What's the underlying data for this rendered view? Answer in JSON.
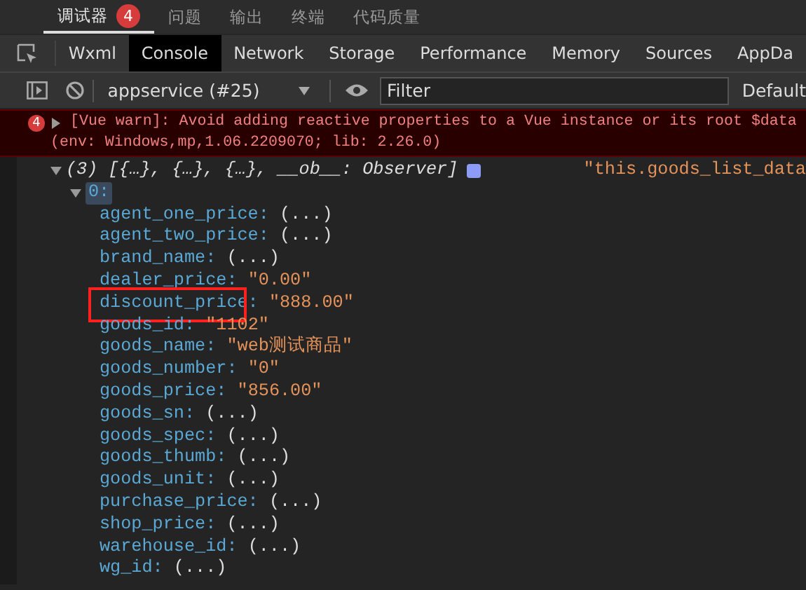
{
  "top_tabs": [
    {
      "label": "调试器",
      "selected": true,
      "badge": "4"
    },
    {
      "label": "问题",
      "selected": false
    },
    {
      "label": "输出",
      "selected": false
    },
    {
      "label": "终端",
      "selected": false
    },
    {
      "label": "代码质量",
      "selected": false
    }
  ],
  "panel_tabs": [
    {
      "label": "Wxml",
      "selected": false
    },
    {
      "label": "Console",
      "selected": true
    },
    {
      "label": "Network",
      "selected": false
    },
    {
      "label": "Storage",
      "selected": false
    },
    {
      "label": "Performance",
      "selected": false
    },
    {
      "label": "Memory",
      "selected": false
    },
    {
      "label": "Sources",
      "selected": false
    },
    {
      "label": "AppDa",
      "selected": false
    }
  ],
  "toolbar": {
    "context": "appservice (#25)",
    "filter_placeholder": "Filter",
    "levels": "Default"
  },
  "warning": {
    "count": "4",
    "lines": [
      "[Vue warn]: Avoid adding reactive properties to a Vue instance or its root $data",
      "(env: Windows,mp,1.06.2209070; lib: 2.26.0)"
    ]
  },
  "log": {
    "summary": "(3) [{…}, {…}, {…}, __ob__: Observer]",
    "source": "\"this.goods_list_data",
    "expanded": true,
    "item": {
      "label": "0:",
      "selected": true,
      "expanded": true,
      "fields": [
        {
          "key": "agent_one_price:",
          "value": "(...)",
          "kind": "getter",
          "highlighted": false
        },
        {
          "key": "agent_two_price:",
          "value": "(...)",
          "kind": "getter",
          "highlighted": false
        },
        {
          "key": "brand_name:",
          "value": "(...)",
          "kind": "getter",
          "highlighted": false
        },
        {
          "key": "dealer_price:",
          "value": "\"0.00\"",
          "kind": "string",
          "highlighted": false
        },
        {
          "key": "discount_price:",
          "value": "\"888.00\"",
          "kind": "string",
          "highlighted": true
        },
        {
          "key": "goods_id:",
          "value": "\"1102\"",
          "kind": "string",
          "highlighted": false
        },
        {
          "key": "goods_name:",
          "value": "\"web测试商品\"",
          "kind": "string",
          "highlighted": false
        },
        {
          "key": "goods_number:",
          "value": "\"0\"",
          "kind": "string",
          "highlighted": false
        },
        {
          "key": "goods_price:",
          "value": "\"856.00\"",
          "kind": "string",
          "highlighted": false
        },
        {
          "key": "goods_sn:",
          "value": "(...)",
          "kind": "getter",
          "highlighted": false
        },
        {
          "key": "goods_spec:",
          "value": "(...)",
          "kind": "getter",
          "highlighted": false
        },
        {
          "key": "goods_thumb:",
          "value": "(...)",
          "kind": "getter",
          "highlighted": false
        },
        {
          "key": "goods_unit:",
          "value": "(...)",
          "kind": "getter",
          "highlighted": false
        },
        {
          "key": "purchase_price:",
          "value": "(...)",
          "kind": "getter",
          "highlighted": false
        },
        {
          "key": "shop_price:",
          "value": "(...)",
          "kind": "getter",
          "highlighted": false
        },
        {
          "key": "warehouse_id:",
          "value": "(...)",
          "kind": "getter",
          "highlighted": false
        },
        {
          "key": "wg_id:",
          "value": "(...)",
          "kind": "getter",
          "highlighted": false
        }
      ]
    }
  }
}
